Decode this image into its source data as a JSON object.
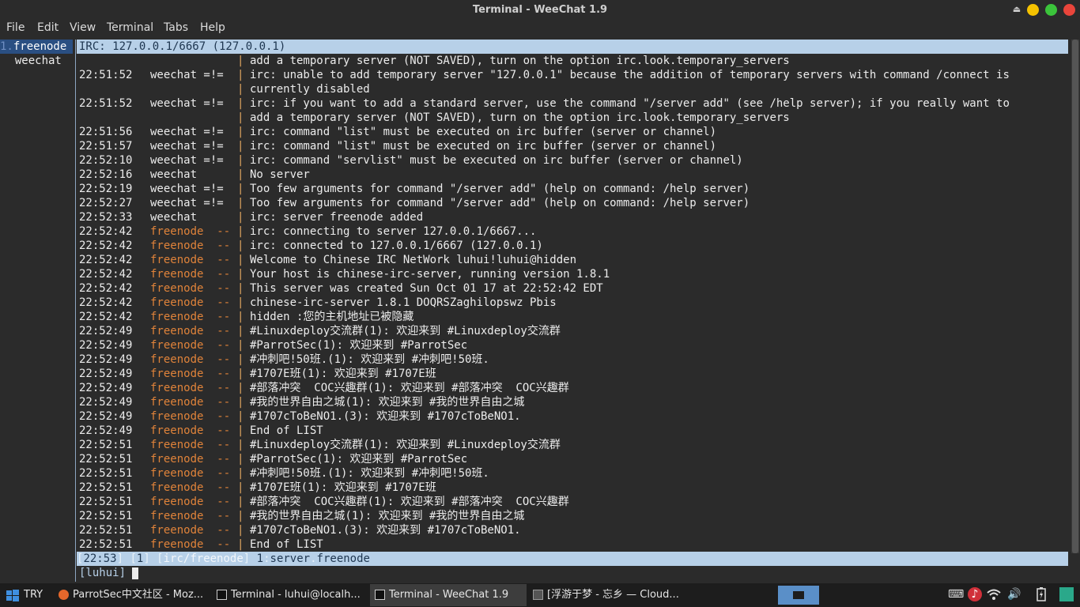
{
  "window": {
    "title": "Terminal - WeeChat 1.9"
  },
  "menu": [
    "File",
    "Edit",
    "View",
    "Terminal",
    "Tabs",
    "Help"
  ],
  "buffers": [
    {
      "num": "1.",
      "name": "freenode"
    },
    {
      "num": "",
      "name": "  weechat"
    }
  ],
  "title_line": "IRC: 127.0.0.1/6667 (127.0.0.1)",
  "chat": [
    {
      "ts": "",
      "pfx": "",
      "k": "c",
      "msg": "add a temporary server (NOT SAVED), turn on the option irc.look.temporary_servers"
    },
    {
      "ts": "22:51:52",
      "pfx": "weechat =!=",
      "k": "w",
      "msg": "irc: unable to add temporary server \"127.0.0.1\" because the addition of temporary servers with command /connect is"
    },
    {
      "ts": "",
      "pfx": "",
      "k": "c",
      "msg": "currently disabled"
    },
    {
      "ts": "22:51:52",
      "pfx": "weechat =!=",
      "k": "w",
      "msg": "irc: if you want to add a standard server, use the command \"/server add\" (see /help server); if you really want to"
    },
    {
      "ts": "",
      "pfx": "",
      "k": "c",
      "msg": "add a temporary server (NOT SAVED), turn on the option irc.look.temporary_servers"
    },
    {
      "ts": "22:51:56",
      "pfx": "weechat =!=",
      "k": "w",
      "msg": "irc: command \"list\" must be executed on irc buffer (server or channel)"
    },
    {
      "ts": "22:51:57",
      "pfx": "weechat =!=",
      "k": "w",
      "msg": "irc: command \"list\" must be executed on irc buffer (server or channel)"
    },
    {
      "ts": "22:52:10",
      "pfx": "weechat =!=",
      "k": "w",
      "msg": "irc: command \"servlist\" must be executed on irc buffer (server or channel)"
    },
    {
      "ts": "22:52:16",
      "pfx": "weechat",
      "k": "w",
      "msg": "No server"
    },
    {
      "ts": "22:52:19",
      "pfx": "weechat =!=",
      "k": "w",
      "msg": "Too few arguments for command \"/server add\" (help on command: /help server)"
    },
    {
      "ts": "22:52:27",
      "pfx": "weechat =!=",
      "k": "w",
      "msg": "Too few arguments for command \"/server add\" (help on command: /help server)"
    },
    {
      "ts": "22:52:33",
      "pfx": "weechat",
      "k": "w",
      "msg": "irc: server freenode added"
    },
    {
      "ts": "22:52:42",
      "pfx": "freenode  --",
      "k": "i",
      "msg": "irc: connecting to server 127.0.0.1/6667..."
    },
    {
      "ts": "22:52:42",
      "pfx": "freenode  --",
      "k": "i",
      "msg": "irc: connected to 127.0.0.1/6667 (127.0.0.1)"
    },
    {
      "ts": "22:52:42",
      "pfx": "freenode  --",
      "k": "i",
      "msg": "Welcome to Chinese IRC NetWork luhui!luhui@hidden"
    },
    {
      "ts": "22:52:42",
      "pfx": "freenode  --",
      "k": "i",
      "msg": "Your host is chinese-irc-server, running version 1.8.1"
    },
    {
      "ts": "22:52:42",
      "pfx": "freenode  --",
      "k": "i",
      "msg": "This server was created Sun Oct 01 17 at 22:52:42 EDT"
    },
    {
      "ts": "22:52:42",
      "pfx": "freenode  --",
      "k": "i",
      "msg": "chinese-irc-server 1.8.1 DOQRSZaghilopswz Pbis"
    },
    {
      "ts": "22:52:42",
      "pfx": "freenode  --",
      "k": "i",
      "msg": "hidden :您的主机地址已被隐藏"
    },
    {
      "ts": "22:52:49",
      "pfx": "freenode  --",
      "k": "i",
      "msg": "#Linuxdeploy交流群(1): 欢迎来到 #Linuxdeploy交流群"
    },
    {
      "ts": "22:52:49",
      "pfx": "freenode  --",
      "k": "i",
      "msg": "#ParrotSec(1): 欢迎来到 #ParrotSec"
    },
    {
      "ts": "22:52:49",
      "pfx": "freenode  --",
      "k": "i",
      "msg": "#冲刺吧!50班.(1): 欢迎来到 #冲刺吧!50班."
    },
    {
      "ts": "22:52:49",
      "pfx": "freenode  --",
      "k": "i",
      "msg": "#1707E班(1): 欢迎来到 #1707E班"
    },
    {
      "ts": "22:52:49",
      "pfx": "freenode  --",
      "k": "i",
      "msg": "#部落冲突  COC兴趣群(1): 欢迎来到 #部落冲突  COC兴趣群"
    },
    {
      "ts": "22:52:49",
      "pfx": "freenode  --",
      "k": "i",
      "msg": "#我的世界自由之城(1): 欢迎来到 #我的世界自由之城"
    },
    {
      "ts": "22:52:49",
      "pfx": "freenode  --",
      "k": "i",
      "msg": "#1707cToBeNO1.(3): 欢迎来到 #1707cToBeNO1."
    },
    {
      "ts": "22:52:49",
      "pfx": "freenode  --",
      "k": "i",
      "msg": "End of LIST"
    },
    {
      "ts": "22:52:51",
      "pfx": "freenode  --",
      "k": "i",
      "msg": "#Linuxdeploy交流群(1): 欢迎来到 #Linuxdeploy交流群"
    },
    {
      "ts": "22:52:51",
      "pfx": "freenode  --",
      "k": "i",
      "msg": "#ParrotSec(1): 欢迎来到 #ParrotSec"
    },
    {
      "ts": "22:52:51",
      "pfx": "freenode  --",
      "k": "i",
      "msg": "#冲刺吧!50班.(1): 欢迎来到 #冲刺吧!50班."
    },
    {
      "ts": "22:52:51",
      "pfx": "freenode  --",
      "k": "i",
      "msg": "#1707E班(1): 欢迎来到 #1707E班"
    },
    {
      "ts": "22:52:51",
      "pfx": "freenode  --",
      "k": "i",
      "msg": "#部落冲突  COC兴趣群(1): 欢迎来到 #部落冲突  COC兴趣群"
    },
    {
      "ts": "22:52:51",
      "pfx": "freenode  --",
      "k": "i",
      "msg": "#我的世界自由之城(1): 欢迎来到 #我的世界自由之城"
    },
    {
      "ts": "22:52:51",
      "pfx": "freenode  --",
      "k": "i",
      "msg": "#1707cToBeNO1.(3): 欢迎来到 #1707cToBeNO1."
    },
    {
      "ts": "22:52:51",
      "pfx": "freenode  --",
      "k": "i",
      "msg": "End of LIST"
    }
  ],
  "status": {
    "time": "22:53",
    "bufnum": "1",
    "bufname": "irc/freenode",
    "num": "1",
    "label": "server",
    "value": "freenode"
  },
  "input": {
    "prompt": "[luhui]"
  },
  "taskbar": {
    "start": "TRY",
    "tasks": [
      {
        "label": "ParrotSec中文社区 - Moz...",
        "icon": "firefox-icon"
      },
      {
        "label": "Terminal - luhui@localh...",
        "icon": "terminal-icon"
      },
      {
        "label": "Terminal - WeeChat 1.9",
        "icon": "terminal-icon"
      },
      {
        "label": "[浮游于梦 - 忘乡 — Cloud...",
        "icon": "music-player-icon"
      }
    ]
  },
  "colors": {
    "accent": "#b7d0e8",
    "buffer_sel": "#2a4f82",
    "nick_server": "#e0833a"
  }
}
